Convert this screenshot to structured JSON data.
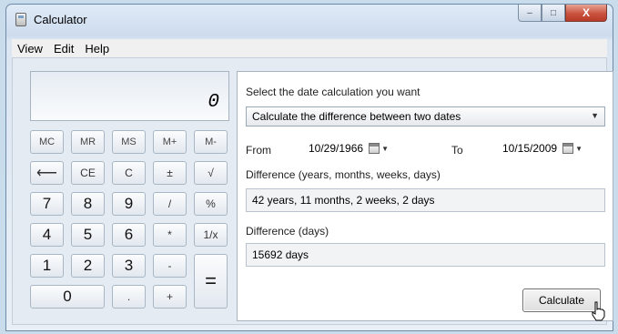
{
  "window": {
    "title": "Calculator"
  },
  "caption": {
    "minimize": "–",
    "maximize": "□",
    "close": "X"
  },
  "menu": {
    "view": "View",
    "edit": "Edit",
    "help": "Help"
  },
  "display": {
    "value": "0"
  },
  "keys": {
    "mc": "MC",
    "mr": "MR",
    "ms": "MS",
    "mplus": "M+",
    "mminus": "M-",
    "backspace": "⟵",
    "ce": "CE",
    "c": "C",
    "plusminus": "±",
    "sqrt": "√",
    "seven": "7",
    "eight": "8",
    "nine": "9",
    "divide": "/",
    "percent": "%",
    "four": "4",
    "five": "5",
    "six": "6",
    "multiply": "*",
    "reciprocal": "1/x",
    "one": "1",
    "two": "2",
    "three": "3",
    "minus": "-",
    "equals": "=",
    "zero": "0",
    "decimal": ".",
    "plus": "+"
  },
  "date_calc": {
    "prompt": "Select the date calculation you want",
    "mode": "Calculate the difference between two dates",
    "from_label": "From",
    "from_date": "10/29/1966",
    "to_label": "To",
    "to_date": "10/15/2009",
    "diff_label": "Difference (years, months, weeks, days)",
    "diff_value": "42 years, 11 months, 2 weeks, 2 days",
    "days_label": "Difference (days)",
    "days_value": "15692 days",
    "calculate": "Calculate"
  }
}
